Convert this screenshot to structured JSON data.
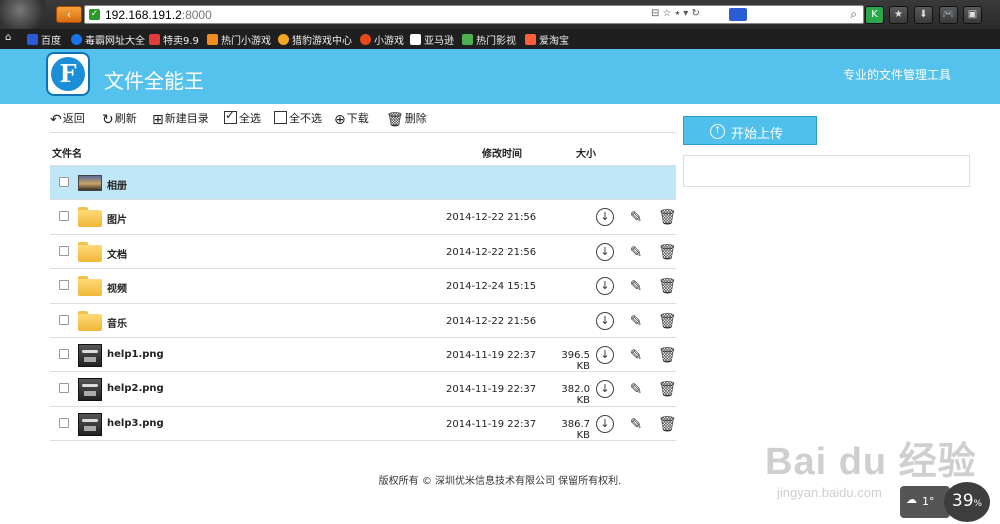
{
  "browser": {
    "back_label": "‹",
    "url_host": "192.168.191.2",
    "url_port": ":8000",
    "addr_icons": "⊟ ☆ ⭑ ▾ ↻",
    "search_engine_icon": "paw-icon",
    "toolbar_buttons": [
      "K",
      "★",
      "⬇",
      "🎮",
      "▣"
    ],
    "bookmarks": [
      {
        "label": "百度",
        "color": "#2b5bd7"
      },
      {
        "label": "毒霸网址大全",
        "color": "#1a73e8"
      },
      {
        "label": "特卖9.9",
        "color": "#e23b3b"
      },
      {
        "label": "热门小游戏",
        "color": "#f28c1e"
      },
      {
        "label": "猎豹游戏中心",
        "color": "#f5a623"
      },
      {
        "label": "小游戏",
        "color": "#e64a19"
      },
      {
        "label": "亚马逊",
        "color": "#ffffff"
      },
      {
        "label": "热门影视",
        "color": "#4caf50"
      },
      {
        "label": "爱淘宝",
        "color": "#ff5e3a"
      }
    ]
  },
  "app": {
    "logo_letter": "F",
    "title": "文件全能王",
    "slogan": "专业的文件管理工具",
    "accent": "#55c2ee"
  },
  "toolbar": {
    "back": "返回",
    "refresh": "刷新",
    "new_dir": "新建目录",
    "select_all": "全选",
    "select_none": "全不选",
    "download": "下载",
    "delete": "删除"
  },
  "table": {
    "col_name": "文件名",
    "col_modified": "修改时间",
    "col_size": "大小",
    "rows": [
      {
        "name": "相册",
        "kind": "album",
        "modified": "",
        "size": "",
        "selected": true
      },
      {
        "name": "图片",
        "kind": "folder",
        "modified": "2014-12-22 21:56",
        "size": ""
      },
      {
        "name": "文档",
        "kind": "folder",
        "modified": "2014-12-22 21:56",
        "size": ""
      },
      {
        "name": "视频",
        "kind": "folder",
        "modified": "2014-12-24 15:15",
        "size": ""
      },
      {
        "name": "音乐",
        "kind": "folder",
        "modified": "2014-12-22 21:56",
        "size": ""
      },
      {
        "name": "help1.png",
        "kind": "image",
        "modified": "2014-11-19 22:37",
        "size": "396.5 KB"
      },
      {
        "name": "help2.png",
        "kind": "image",
        "modified": "2014-11-19 22:37",
        "size": "382.0 KB"
      },
      {
        "name": "help3.png",
        "kind": "image",
        "modified": "2014-11-19 22:37",
        "size": "386.7 KB"
      }
    ]
  },
  "upload": {
    "label": "开始上传"
  },
  "footer": "版权所有 © 深圳优米信息技术有限公司 保留所有权利.",
  "watermark": {
    "big": "Bai du 经验",
    "small": "jingyan.baidu.com"
  },
  "weather": "1°",
  "badge": {
    "value": "39",
    "unit": "%"
  }
}
